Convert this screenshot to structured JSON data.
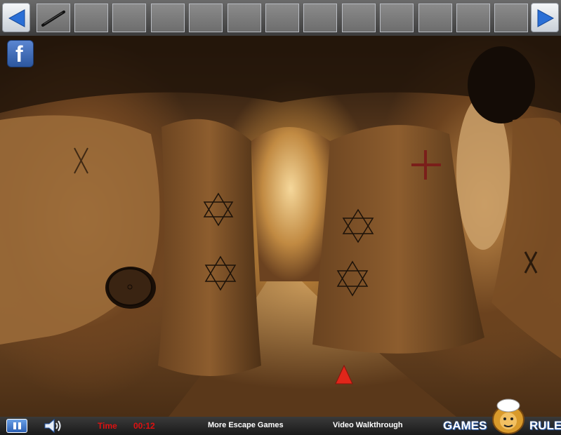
{
  "inventory": {
    "slots": [
      "stick",
      "",
      "",
      "",
      "",
      "",
      "",
      "",
      "",
      "",
      "",
      "",
      ""
    ]
  },
  "icons": {
    "prev": "left-arrow-icon",
    "next": "right-arrow-icon",
    "facebook": "facebook-icon",
    "pause": "pause-icon",
    "sound": "speaker-icon"
  },
  "facebook": {
    "letter": "f"
  },
  "scene": {
    "clues": [
      "x-mark",
      "star-of-david",
      "star-of-david",
      "star-of-david",
      "star-of-david",
      "cross",
      "x-mark"
    ],
    "wall_disc": "round-wall-disc",
    "nav_arrow": "up-arrow"
  },
  "footer": {
    "timer_label": "Time",
    "timer_value": "00:12",
    "more_games": "More Escape Games",
    "walkthrough": "Video Walkthrough",
    "logo_left": "GAMES",
    "logo_right": "RULE"
  },
  "colors": {
    "timer": "#dd1111",
    "arrow": "#2a6fd6",
    "nav_arrow": "#e0261a"
  }
}
